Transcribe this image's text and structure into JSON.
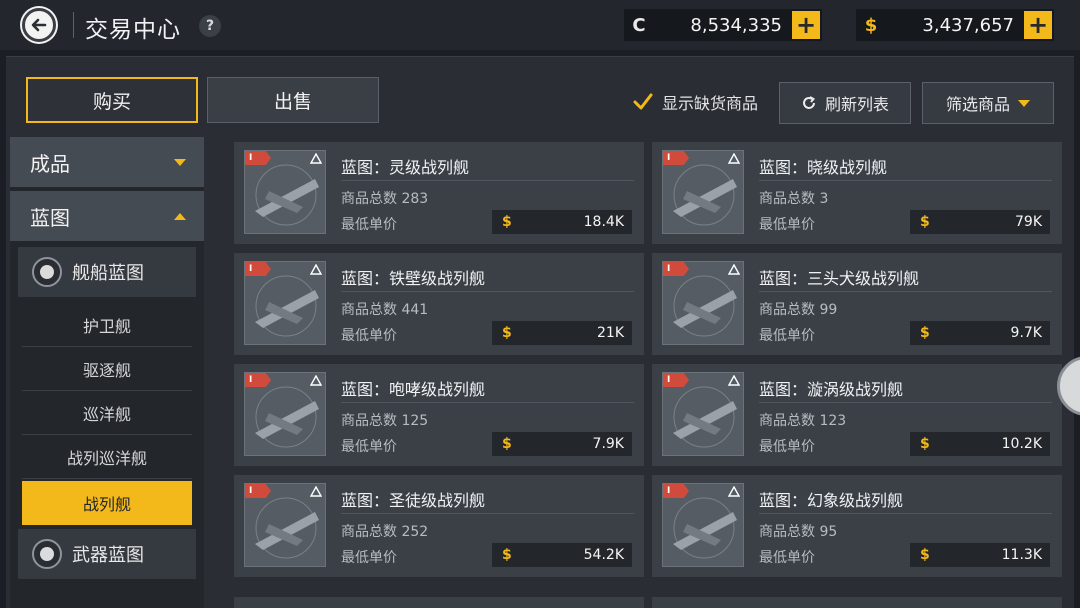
{
  "header": {
    "title": "交易中心",
    "help": "?",
    "currencies": [
      {
        "icon": "C",
        "value": "8,534,335",
        "plus": "+"
      },
      {
        "icon": "$",
        "value": "3,437,657",
        "plus": "+"
      }
    ]
  },
  "tabs": {
    "buy": "购买",
    "sell": "出售"
  },
  "controls": {
    "show_out_of_stock": "显示缺货商品",
    "refresh": "刷新列表",
    "filter": "筛选商品"
  },
  "sidebar": {
    "categories": [
      {
        "label": "成品"
      },
      {
        "label": "蓝图"
      }
    ],
    "ship_blueprint": "舰船蓝图",
    "ship_types": [
      "护卫舰",
      "驱逐舰",
      "巡洋舰",
      "战列巡洋舰",
      "战列舰"
    ],
    "weapon_blueprint": "武器蓝图"
  },
  "common": {
    "count_label": "商品总数",
    "price_label": "最低单价",
    "price_icon": "$",
    "badge": "I"
  },
  "items": [
    {
      "name": "蓝图：灵级战列舰",
      "count": "283",
      "price": "18.4K"
    },
    {
      "name": "蓝图：晓级战列舰",
      "count": "3",
      "price": "79K"
    },
    {
      "name": "蓝图：铁壁级战列舰",
      "count": "441",
      "price": "21K"
    },
    {
      "name": "蓝图：三头犬级战列舰",
      "count": "99",
      "price": "9.7K"
    },
    {
      "name": "蓝图：咆哮级战列舰",
      "count": "125",
      "price": "7.9K"
    },
    {
      "name": "蓝图：漩涡级战列舰",
      "count": "123",
      "price": "10.2K"
    },
    {
      "name": "蓝图：圣徒级战列舰",
      "count": "252",
      "price": "54.2K"
    },
    {
      "name": "蓝图：幻象级战列舰",
      "count": "95",
      "price": "11.3K"
    }
  ],
  "colors": {
    "accent": "#f3b81a",
    "panel": "#2a2e34",
    "card": "#3b4047"
  }
}
